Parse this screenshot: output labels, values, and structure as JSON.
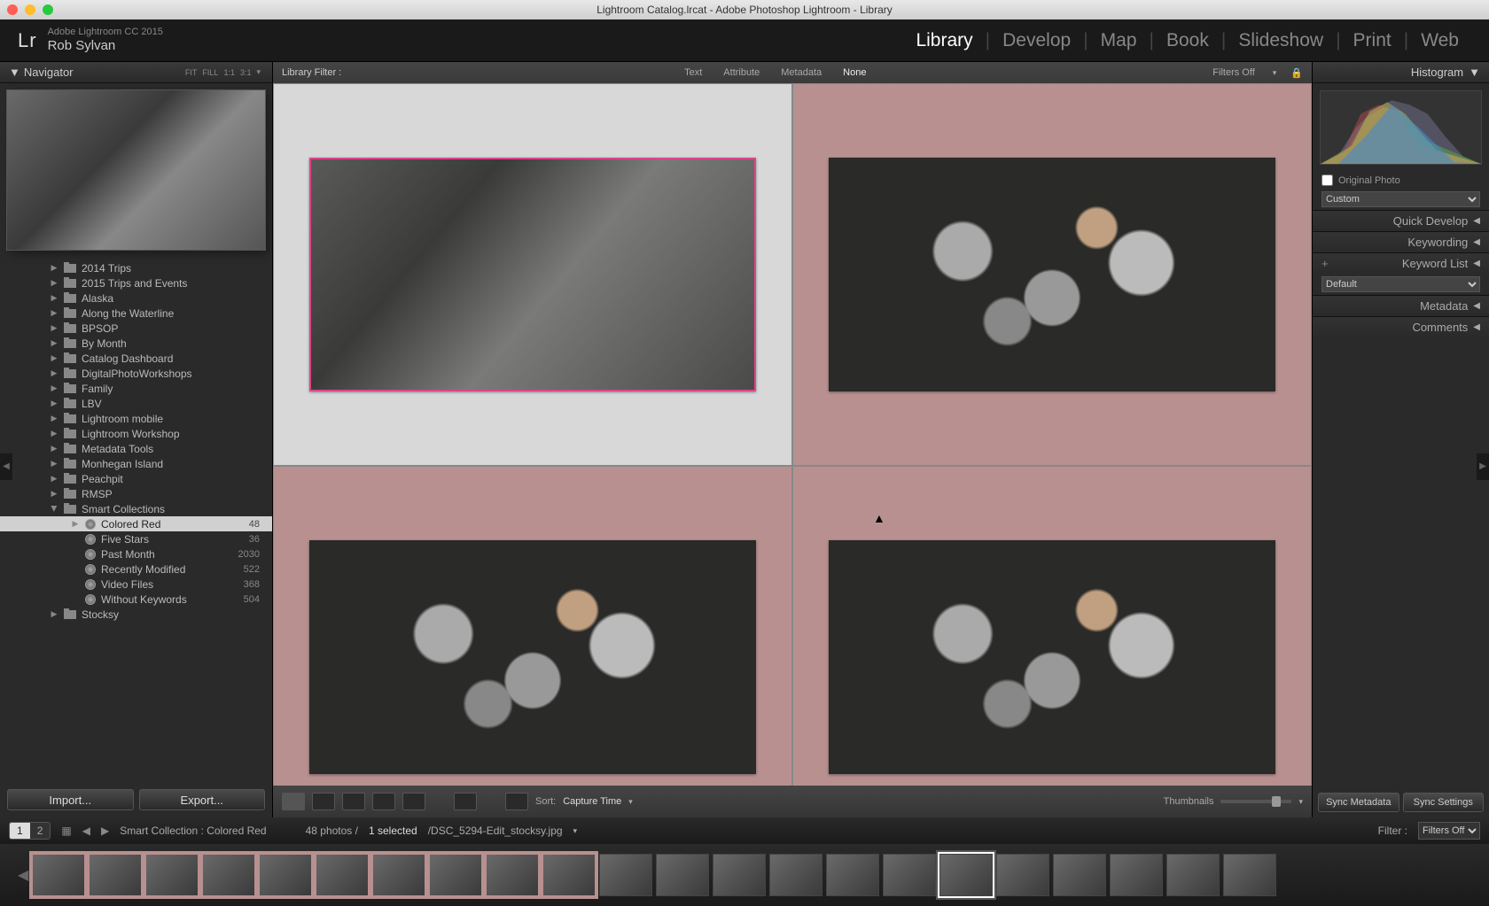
{
  "window_title": "Lightroom Catalog.lrcat - Adobe Photoshop Lightroom - Library",
  "app_version": "Adobe Lightroom CC 2015",
  "user": "Rob Sylvan",
  "modules": [
    "Library",
    "Develop",
    "Map",
    "Book",
    "Slideshow",
    "Print",
    "Web"
  ],
  "active_module": "Library",
  "navigator": {
    "title": "Navigator",
    "fit_opts": [
      "FIT",
      "FILL",
      "1:1",
      "3:1"
    ]
  },
  "folders": [
    {
      "label": "2014 Trips"
    },
    {
      "label": "2015 Trips and Events"
    },
    {
      "label": "Alaska"
    },
    {
      "label": "Along the Waterline"
    },
    {
      "label": "BPSOP"
    },
    {
      "label": "By Month"
    },
    {
      "label": "Catalog Dashboard"
    },
    {
      "label": "DigitalPhotoWorkshops"
    },
    {
      "label": "Family"
    },
    {
      "label": "LBV"
    },
    {
      "label": "Lightroom mobile"
    },
    {
      "label": "Lightroom Workshop"
    },
    {
      "label": "Metadata Tools"
    },
    {
      "label": "Monhegan Island"
    },
    {
      "label": "Peachpit"
    },
    {
      "label": "RMSP"
    }
  ],
  "smart_collections_label": "Smart Collections",
  "smart_collections": [
    {
      "label": "Colored Red",
      "count": 48,
      "selected": true
    },
    {
      "label": "Five Stars",
      "count": 36
    },
    {
      "label": "Past Month",
      "count": 2030
    },
    {
      "label": "Recently Modified",
      "count": 522
    },
    {
      "label": "Video Files",
      "count": 368
    },
    {
      "label": "Without Keywords",
      "count": 504
    }
  ],
  "stocksy_label": "Stocksy",
  "buttons": {
    "import": "Import...",
    "export": "Export..."
  },
  "filter_bar": {
    "label": "Library Filter :",
    "opts": [
      "Text",
      "Attribute",
      "Metadata",
      "None"
    ],
    "active": "None",
    "filters_off": "Filters Off"
  },
  "toolbar": {
    "sort_label": "Sort:",
    "sort_value": "Capture Time",
    "thumbnails_label": "Thumbnails"
  },
  "right_panel": {
    "histogram": "Histogram",
    "original_photo": "Original Photo",
    "custom": "Custom",
    "quick_develop": "Quick Develop",
    "keywording": "Keywording",
    "keyword_list": "Keyword List",
    "default": "Default",
    "metadata": "Metadata",
    "comments": "Comments",
    "sync_metadata": "Sync Metadata",
    "sync_settings": "Sync Settings"
  },
  "status": {
    "secondary": [
      "1",
      "2"
    ],
    "breadcrumb": "Smart Collection : Colored Red",
    "count_text": "48 photos /",
    "selected_text": "1 selected",
    "filename": "/DSC_5294-Edit_stocksy.jpg",
    "filter_label": "Filter :",
    "filter_value": "Filters Off"
  },
  "filmstrip_count": 22,
  "filmstrip_selected": 16
}
